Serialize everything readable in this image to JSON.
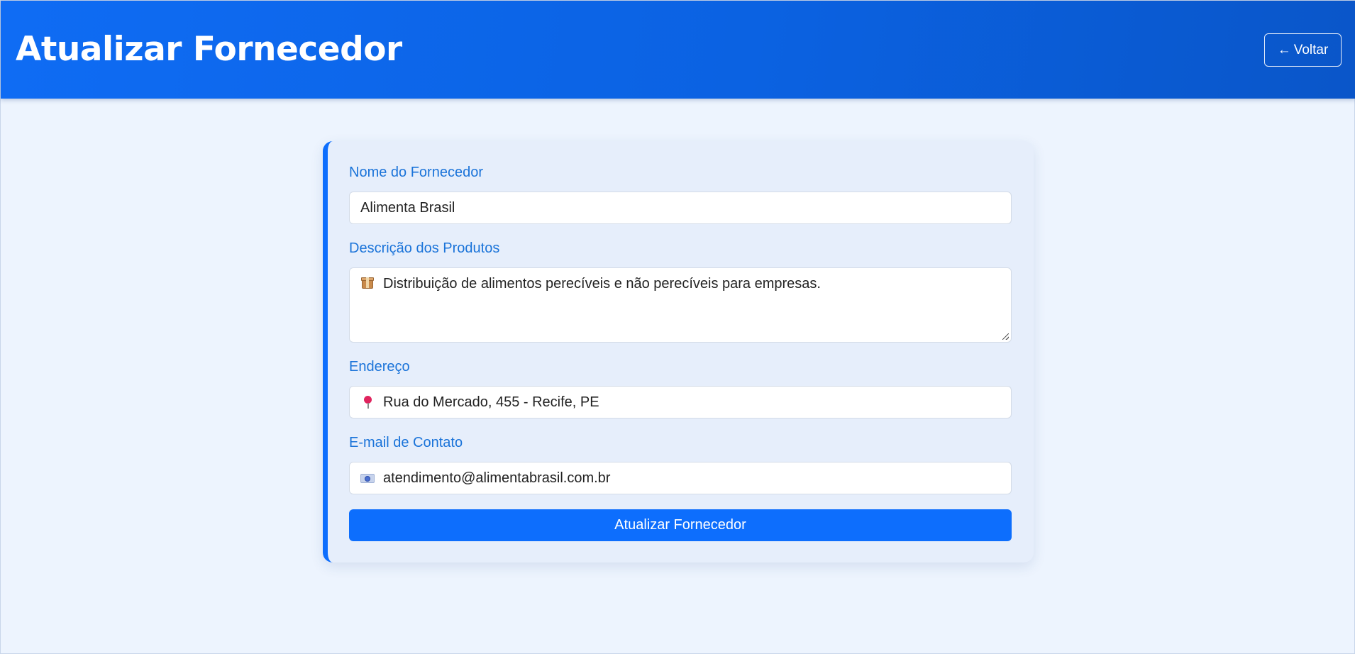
{
  "header": {
    "title": "Atualizar Fornecedor",
    "back_arrow": "←",
    "back_label": "Voltar"
  },
  "form": {
    "name": {
      "label": "Nome do Fornecedor",
      "value": "Alimenta Brasil"
    },
    "description": {
      "label": "Descrição dos Produtos",
      "icon": "package-icon",
      "value": "Distribuição de alimentos perecíveis e não perecíveis para empresas."
    },
    "address": {
      "label": "Endereço",
      "icon": "pin-icon",
      "value": "Rua do Mercado, 455 - Recife, PE"
    },
    "email": {
      "label": "E-mail de Contato",
      "icon": "email-icon",
      "value": "atendimento@alimentabrasil.com.br"
    },
    "submit_label": "Atualizar Fornecedor"
  },
  "colors": {
    "primary": "#0d6efd",
    "label": "#1a73d9",
    "page_background": "#edf4fe",
    "card_background": "#e6eefb"
  }
}
